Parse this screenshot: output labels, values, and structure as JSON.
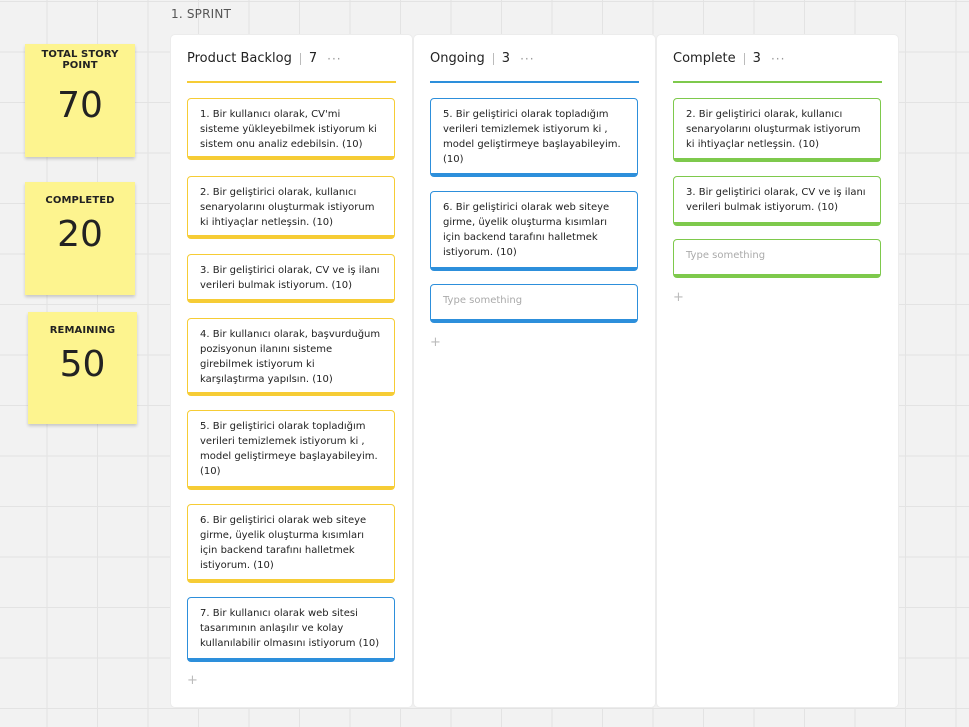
{
  "frame": {
    "title": "1. SPRINT"
  },
  "stickies": [
    {
      "label": "TOTAL STORY POINT",
      "value": "70"
    },
    {
      "label": "COMPLETED",
      "value": "20"
    },
    {
      "label": "REMAINING",
      "value": "50"
    }
  ],
  "columns": [
    {
      "title": "Product Backlog",
      "count": "7",
      "more": "···",
      "accent": "#f6cc35",
      "cards": [
        "1. Bir kullanıcı olarak, CV'mi sisteme yükleyebilmek istiyorum ki sistem onu analiz edebilsin.      (10)",
        "2. Bir geliştirici olarak, kullanıcı senaryolarını oluşturmak istiyorum ki ihtiyaçlar netleşsin. (10)",
        "3. Bir geliştirici olarak, CV ve iş ilanı verileri bulmak istiyorum. (10)",
        "4. Bir kullanıcı olarak, başvurduğum pozisyonun ilanını sisteme girebilmek istiyorum ki karşılaştırma yapılsın. (10)",
        "5. Bir geliştirici olarak topladığım verileri temizlemek istiyorum ki , model geliştirmeye başlayabileyim. (10)",
        "6. Bir geliştirici olarak web siteye girme, üyelik oluşturma kısımları için backend tarafını halletmek istiyorum. (10)",
        "7. Bir kullanıcı olarak web sitesi tasarımının anlaşılır ve kolay kullanılabilir olmasını istiyorum (10)"
      ],
      "add": "+"
    },
    {
      "title": "Ongoing",
      "count": "3",
      "more": "···",
      "accent": "#2d8fdb",
      "cards": [
        "5. Bir geliştirici olarak topladığım verileri temizlemek istiyorum ki , model geliştirmeye başlayabileyim. (10)",
        "6. Bir geliştirici olarak web siteye girme, üyelik oluşturma kısımları için backend tarafını halletmek istiyorum. (10)"
      ],
      "placeholder": "Type something",
      "add": "+"
    },
    {
      "title": "Complete",
      "count": "3",
      "more": "···",
      "accent": "#7ec94c",
      "cards": [
        "2. Bir geliştirici olarak, kullanıcı senaryolarını oluşturmak istiyorum ki ihtiyaçlar netleşsin. (10)",
        "3. Bir geliştirici olarak, CV ve iş ilanı verileri bulmak istiyorum. (10)"
      ],
      "placeholder": "Type something",
      "add": "+"
    }
  ]
}
